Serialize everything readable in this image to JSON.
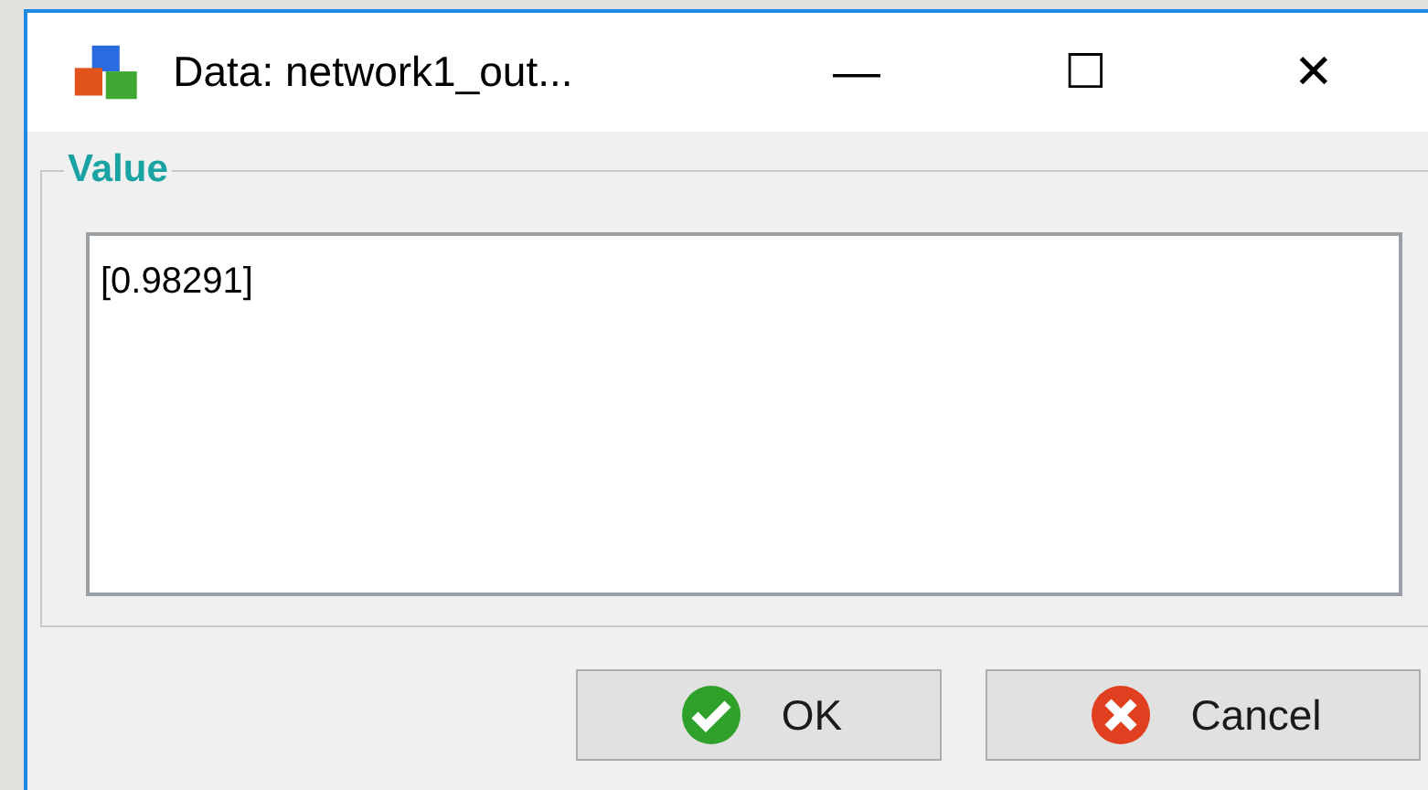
{
  "window": {
    "title": "Data: network1_out...",
    "controls": [
      "—",
      "☐",
      "✕"
    ]
  },
  "group": {
    "label": "Value",
    "value": "[0.98291]"
  },
  "buttons": [
    {
      "label": "OK",
      "kind": "ok"
    },
    {
      "label": "Cancel",
      "kind": "cancel"
    }
  ]
}
